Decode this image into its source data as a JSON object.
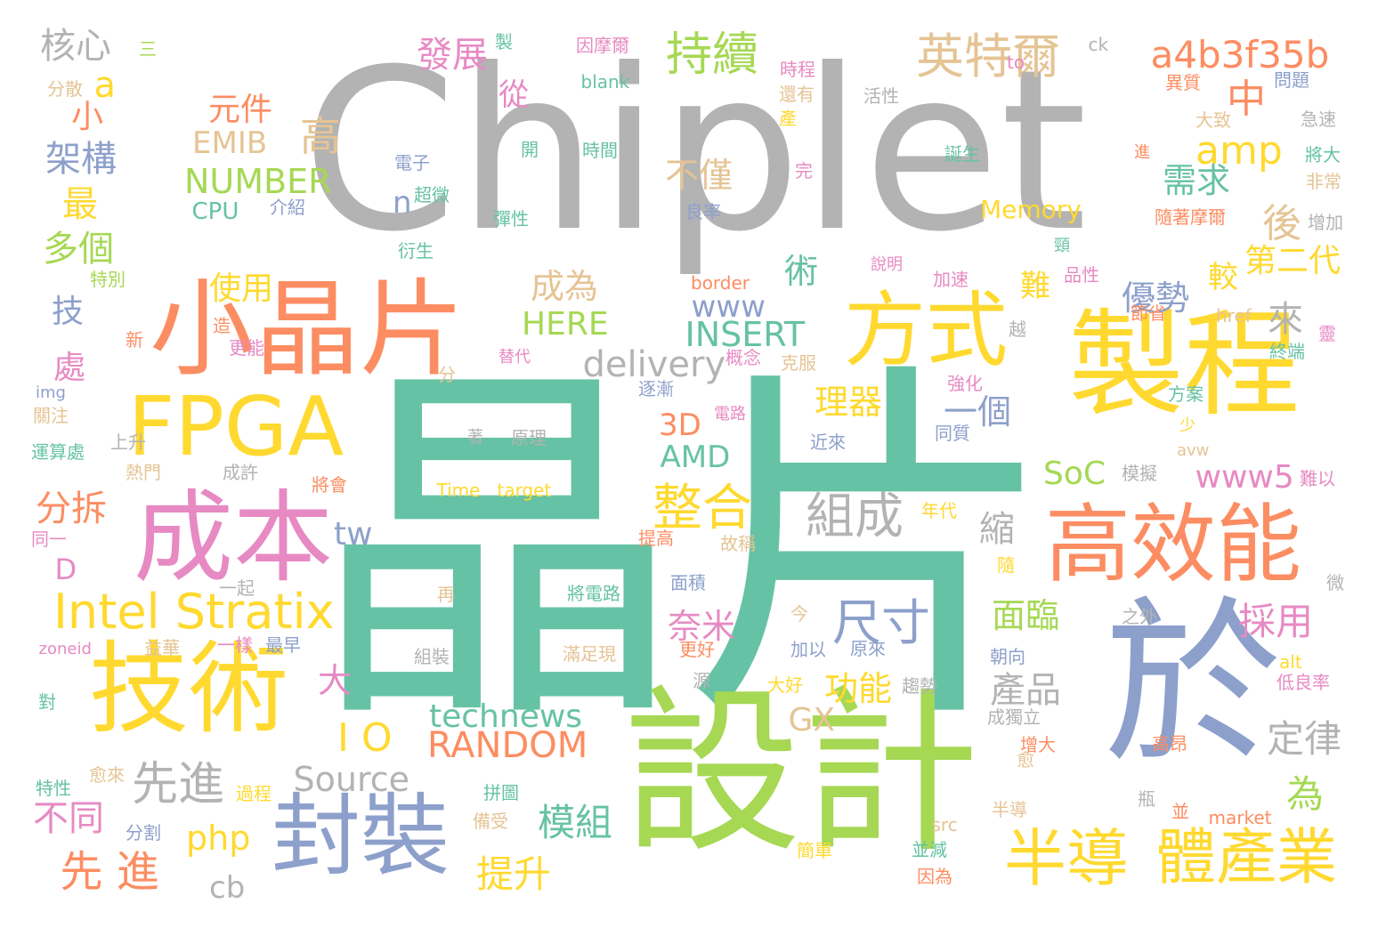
{
  "palette": {
    "gray": "#b3b3b3",
    "teal": "#66c2a5",
    "orange": "#fc8d62",
    "blue": "#8da0cb",
    "pink": "#e78ac3",
    "green": "#a6d854",
    "yellow": "#ffd92f",
    "tan": "#e5c494"
  },
  "words": [
    {
      "text": "Chiplet",
      "color": "gray"
    },
    {
      "text": "晶片",
      "color": "teal"
    },
    {
      "text": "設計",
      "color": "green"
    },
    {
      "text": "於",
      "color": "blue"
    },
    {
      "text": "製程",
      "color": "yellow"
    },
    {
      "text": "小晶片",
      "color": "orange"
    },
    {
      "text": "FPGA",
      "color": "yellow"
    },
    {
      "text": "成本",
      "color": "pink"
    },
    {
      "text": "技術",
      "color": "yellow"
    },
    {
      "text": "封裝",
      "color": "blue"
    },
    {
      "text": "高效能",
      "color": "orange"
    },
    {
      "text": "方式",
      "color": "yellow"
    },
    {
      "text": "半導",
      "color": "yellow"
    },
    {
      "text": "體產業",
      "color": "yellow"
    },
    {
      "text": "Intel Stratix",
      "color": "yellow"
    },
    {
      "text": "英特爾",
      "color": "tan"
    },
    {
      "text": "a4b3f35b",
      "color": "orange"
    },
    {
      "text": "持續",
      "color": "green"
    },
    {
      "text": "整合",
      "color": "yellow"
    },
    {
      "text": "組成",
      "color": "gray"
    },
    {
      "text": "尺寸",
      "color": "blue"
    },
    {
      "text": "delivery",
      "color": "gray"
    },
    {
      "text": "先進",
      "color": "gray"
    },
    {
      "text": "先 進",
      "color": "orange"
    },
    {
      "text": "RANDOM",
      "color": "orange"
    },
    {
      "text": "technews",
      "color": "teal"
    },
    {
      "text": "I O",
      "color": "yellow"
    },
    {
      "text": "Source",
      "color": "gray"
    },
    {
      "text": "amp",
      "color": "yellow"
    },
    {
      "text": "NUMBER",
      "color": "green"
    },
    {
      "text": "EMIB",
      "color": "tan"
    },
    {
      "text": "INSERT",
      "color": "teal"
    },
    {
      "text": "HERE",
      "color": "green"
    },
    {
      "text": "www5",
      "color": "pink"
    },
    {
      "text": "SoC",
      "color": "green"
    },
    {
      "text": "AMD",
      "color": "teal"
    },
    {
      "text": "3D",
      "color": "orange"
    },
    {
      "text": "www",
      "color": "blue"
    },
    {
      "text": "php",
      "color": "yellow"
    },
    {
      "text": "cb",
      "color": "gray"
    },
    {
      "text": "tw",
      "color": "blue"
    },
    {
      "text": "GX",
      "color": "tan"
    },
    {
      "text": "Memory",
      "color": "yellow"
    },
    {
      "text": "CPU",
      "color": "teal"
    },
    {
      "text": "核心",
      "color": "gray"
    },
    {
      "text": "架構",
      "color": "blue"
    },
    {
      "text": "多個",
      "color": "green"
    },
    {
      "text": "分拆",
      "color": "orange"
    },
    {
      "text": "不同",
      "color": "pink"
    },
    {
      "text": "提升",
      "color": "yellow"
    },
    {
      "text": "模組",
      "color": "teal"
    },
    {
      "text": "產品",
      "color": "gray"
    },
    {
      "text": "定律",
      "color": "gray"
    },
    {
      "text": "採用",
      "color": "pink"
    },
    {
      "text": "面臨",
      "color": "green"
    },
    {
      "text": "功能",
      "color": "yellow"
    },
    {
      "text": "奈米",
      "color": "pink"
    },
    {
      "text": "理器",
      "color": "yellow"
    },
    {
      "text": "一個",
      "color": "blue"
    },
    {
      "text": "優勢",
      "color": "blue"
    },
    {
      "text": "第二代",
      "color": "yellow"
    },
    {
      "text": "需求",
      "color": "teal"
    },
    {
      "text": "發展",
      "color": "pink"
    },
    {
      "text": "元件",
      "color": "orange"
    },
    {
      "text": "使用",
      "color": "yellow"
    },
    {
      "text": "成為",
      "color": "tan"
    },
    {
      "text": "不僅",
      "color": "tan"
    },
    {
      "text": "高",
      "color": "tan"
    },
    {
      "text": "最",
      "color": "yellow"
    },
    {
      "text": "中",
      "color": "orange"
    },
    {
      "text": "後",
      "color": "tan"
    },
    {
      "text": "為",
      "color": "green"
    },
    {
      "text": "縮",
      "color": "gray"
    },
    {
      "text": "大",
      "color": "pink"
    },
    {
      "text": "處",
      "color": "pink"
    },
    {
      "text": "技",
      "color": "blue"
    },
    {
      "text": "小",
      "color": "orange"
    },
    {
      "text": "術",
      "color": "teal"
    },
    {
      "text": "來",
      "color": "gray"
    },
    {
      "text": "從",
      "color": "pink"
    },
    {
      "text": "較",
      "color": "yellow"
    },
    {
      "text": "難",
      "color": "yellow"
    },
    {
      "text": "a",
      "color": "yellow"
    },
    {
      "text": "n",
      "color": "blue"
    },
    {
      "text": "D",
      "color": "pink"
    },
    {
      "text": "Time",
      "color": "yellow"
    },
    {
      "text": "target",
      "color": "yellow"
    },
    {
      "text": "著",
      "color": "gray"
    },
    {
      "text": "原理",
      "color": "gray"
    },
    {
      "text": "將電路",
      "color": "teal"
    },
    {
      "text": "滿足現",
      "color": "tan"
    },
    {
      "text": "組裝",
      "color": "gray"
    },
    {
      "text": "再",
      "color": "tan"
    },
    {
      "text": "blank",
      "color": "teal"
    },
    {
      "text": "因摩爾",
      "color": "pink"
    },
    {
      "text": "製",
      "color": "teal"
    },
    {
      "text": "時程",
      "color": "pink"
    },
    {
      "text": "還有",
      "color": "tan"
    },
    {
      "text": "產",
      "color": "yellow"
    },
    {
      "text": "活性",
      "color": "gray"
    },
    {
      "text": "異質",
      "color": "orange"
    },
    {
      "text": "問題",
      "color": "blue"
    },
    {
      "text": "大致",
      "color": "tan"
    },
    {
      "text": "急速",
      "color": "gray"
    },
    {
      "text": "將大",
      "color": "teal"
    },
    {
      "text": "非常",
      "color": "tan"
    },
    {
      "text": "增加",
      "color": "gray"
    },
    {
      "text": "隨著摩爾",
      "color": "orange"
    },
    {
      "text": "誕生",
      "color": "teal"
    },
    {
      "text": "進",
      "color": "orange"
    },
    {
      "text": "電子",
      "color": "blue"
    },
    {
      "text": "超微",
      "color": "teal"
    },
    {
      "text": "介紹",
      "color": "blue"
    },
    {
      "text": "時間",
      "color": "teal"
    },
    {
      "text": "開",
      "color": "teal"
    },
    {
      "text": "完",
      "color": "pink"
    },
    {
      "text": "良率",
      "color": "blue"
    },
    {
      "text": "彈性",
      "color": "teal"
    },
    {
      "text": "衍生",
      "color": "teal"
    },
    {
      "text": "頸",
      "color": "teal"
    },
    {
      "text": "說明",
      "color": "pink"
    },
    {
      "text": "加速",
      "color": "pink"
    },
    {
      "text": "品性",
      "color": "pink"
    },
    {
      "text": "節省",
      "color": "orange"
    },
    {
      "text": "href",
      "color": "tan"
    },
    {
      "text": "終端",
      "color": "teal"
    },
    {
      "text": "靈",
      "color": "pink"
    },
    {
      "text": "border",
      "color": "orange"
    },
    {
      "text": "替代",
      "color": "pink"
    },
    {
      "text": "概念",
      "color": "pink"
    },
    {
      "text": "克服",
      "color": "tan"
    },
    {
      "text": "逐漸",
      "color": "blue"
    },
    {
      "text": "越",
      "color": "gray"
    },
    {
      "text": "強化",
      "color": "pink"
    },
    {
      "text": "方案",
      "color": "teal"
    },
    {
      "text": "少",
      "color": "yellow"
    },
    {
      "text": "電路",
      "color": "pink"
    },
    {
      "text": "近來",
      "color": "blue"
    },
    {
      "text": "同質",
      "color": "blue"
    },
    {
      "text": "模擬",
      "color": "gray"
    },
    {
      "text": "難以",
      "color": "pink"
    },
    {
      "text": "avw",
      "color": "tan"
    },
    {
      "text": "年代",
      "color": "yellow"
    },
    {
      "text": "提高",
      "color": "orange"
    },
    {
      "text": "故稱",
      "color": "tan"
    },
    {
      "text": "隨",
      "color": "yellow"
    },
    {
      "text": "面積",
      "color": "blue"
    },
    {
      "text": "今",
      "color": "tan"
    },
    {
      "text": "加以",
      "color": "blue"
    },
    {
      "text": "原來",
      "color": "blue"
    },
    {
      "text": "之外",
      "color": "gray"
    },
    {
      "text": "微",
      "color": "gray"
    },
    {
      "text": "更好",
      "color": "orange"
    },
    {
      "text": "朝向",
      "color": "blue"
    },
    {
      "text": "源",
      "color": "gray"
    },
    {
      "text": "大好",
      "color": "yellow"
    },
    {
      "text": "趨勢",
      "color": "gray"
    },
    {
      "text": "alt",
      "color": "yellow"
    },
    {
      "text": "低良率",
      "color": "pink"
    },
    {
      "text": "成獨立",
      "color": "gray"
    },
    {
      "text": "高昂",
      "color": "orange"
    },
    {
      "text": "增大",
      "color": "orange"
    },
    {
      "text": "愈",
      "color": "tan"
    },
    {
      "text": "拼圖",
      "color": "teal"
    },
    {
      "text": "瓶",
      "color": "gray"
    },
    {
      "text": "備受",
      "color": "tan"
    },
    {
      "text": "半導",
      "color": "tan"
    },
    {
      "text": "並",
      "color": "orange"
    },
    {
      "text": "market",
      "color": "orange"
    },
    {
      "text": "src",
      "color": "tan"
    },
    {
      "text": "並減",
      "color": "teal"
    },
    {
      "text": "簡單",
      "color": "yellow"
    },
    {
      "text": "因為",
      "color": "orange"
    },
    {
      "text": "三",
      "color": "green"
    },
    {
      "text": "分散",
      "color": "tan"
    },
    {
      "text": "特別",
      "color": "green"
    },
    {
      "text": "新",
      "color": "orange"
    },
    {
      "text": "造",
      "color": "orange"
    },
    {
      "text": "更能",
      "color": "pink"
    },
    {
      "text": "分",
      "color": "tan"
    },
    {
      "text": "img",
      "color": "blue"
    },
    {
      "text": "關注",
      "color": "tan"
    },
    {
      "text": "運算處",
      "color": "teal"
    },
    {
      "text": "上升",
      "color": "gray"
    },
    {
      "text": "熱門",
      "color": "tan"
    },
    {
      "text": "成許",
      "color": "gray"
    },
    {
      "text": "將會",
      "color": "orange"
    },
    {
      "text": "同一",
      "color": "pink"
    },
    {
      "text": "一起",
      "color": "gray"
    },
    {
      "text": "一樣",
      "color": "pink"
    },
    {
      "text": "最早",
      "color": "blue"
    },
    {
      "text": "益華",
      "color": "tan"
    },
    {
      "text": "zoneid",
      "color": "pink"
    },
    {
      "text": "對",
      "color": "teal"
    },
    {
      "text": "愈來",
      "color": "tan"
    },
    {
      "text": "特性",
      "color": "teal"
    },
    {
      "text": "過程",
      "color": "yellow"
    },
    {
      "text": "分割",
      "color": "blue"
    },
    {
      "text": "ck",
      "color": "gray"
    },
    {
      "text": "to",
      "color": "pink"
    }
  ]
}
